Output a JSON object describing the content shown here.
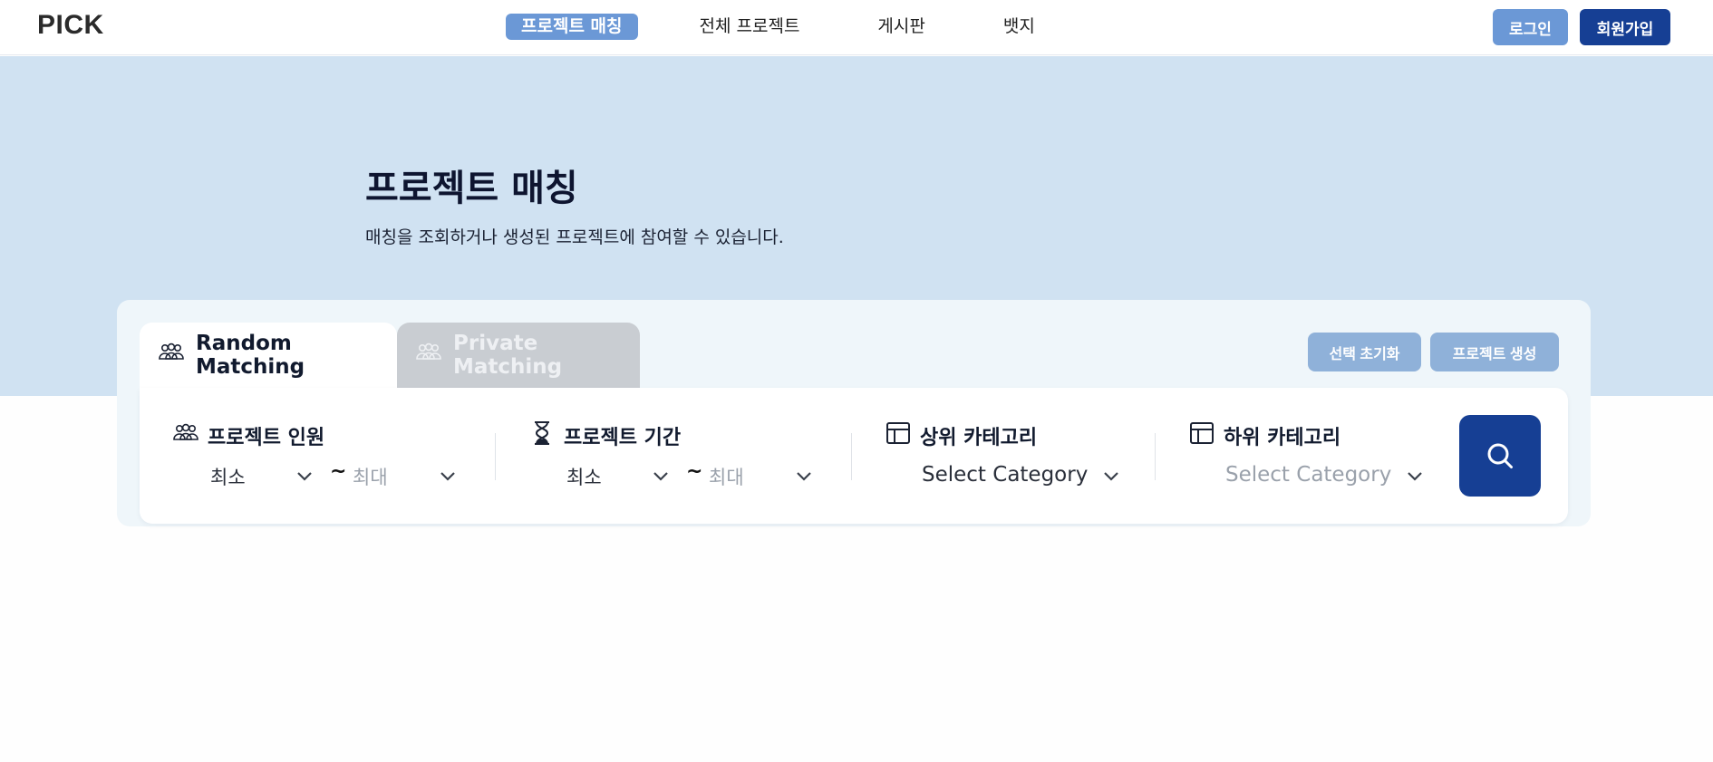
{
  "header": {
    "logo": "PICK",
    "nav": [
      "프로젝트 매칭",
      "전체 프로젝트",
      "게시판",
      "뱃지"
    ],
    "login": "로그인",
    "signup": "회원가입"
  },
  "hero": {
    "title": "프로젝트 매칭",
    "subtitle": "매칭을 조회하거나 생성된 프로젝트에 참여할 수 있습니다."
  },
  "tabs": {
    "random": "Random Matching",
    "private": "Private Matching"
  },
  "actions": {
    "reset": "선택 초기화",
    "create": "프로젝트 생성"
  },
  "filters": {
    "members": {
      "label": "프로젝트 인원",
      "min": "최소",
      "max": "최대"
    },
    "period": {
      "label": "프로젝트 기간",
      "min": "최소",
      "max": "최대"
    },
    "upper_category": {
      "label": "상위 카테고리",
      "value": "Select Category"
    },
    "lower_category": {
      "label": "하위 카테고리",
      "value": "Select Category"
    },
    "tilde": "~"
  },
  "icons": {
    "people": "people-group-icon",
    "hourglass": "hourglass-icon",
    "category": "layout-icon",
    "chevron": "chevron-down-icon",
    "search": "search-icon"
  },
  "colors": {
    "primary": "#163f94",
    "accent": "#6b98d6",
    "hero_bg": "#d0e2f2",
    "muted_button": "#8fb1d9"
  }
}
